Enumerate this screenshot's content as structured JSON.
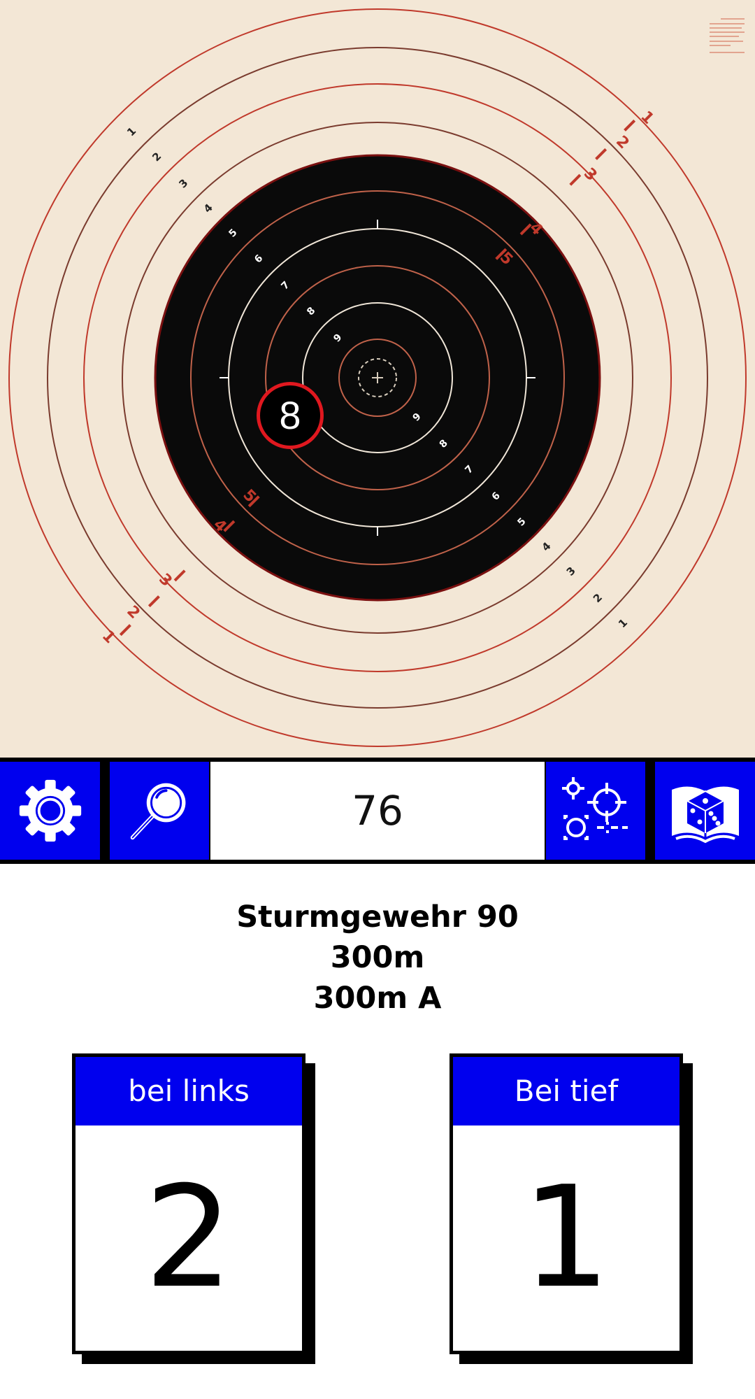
{
  "target": {
    "shot_value": "8",
    "ring_numbers": [
      "1",
      "2",
      "3",
      "4",
      "5",
      "6",
      "7",
      "8",
      "9"
    ]
  },
  "toolbar": {
    "score": "76",
    "icons": {
      "settings": "gear-icon",
      "zoom": "magnifier-icon",
      "sight": "crosshair-adjust-icon",
      "book": "dice-book-icon"
    }
  },
  "info": {
    "weapon": "Sturmgewehr 90",
    "distance": "300m",
    "target_name": "300m A"
  },
  "corrections": {
    "horizontal": {
      "label": "bei links",
      "value": "2"
    },
    "vertical": {
      "label": "Bei tief",
      "value": "1"
    }
  },
  "colors": {
    "accent_blue": "#0000ee",
    "target_paper": "#f3e7d6",
    "ring_red": "#c0392b",
    "shot_ring": "#e0181f"
  }
}
